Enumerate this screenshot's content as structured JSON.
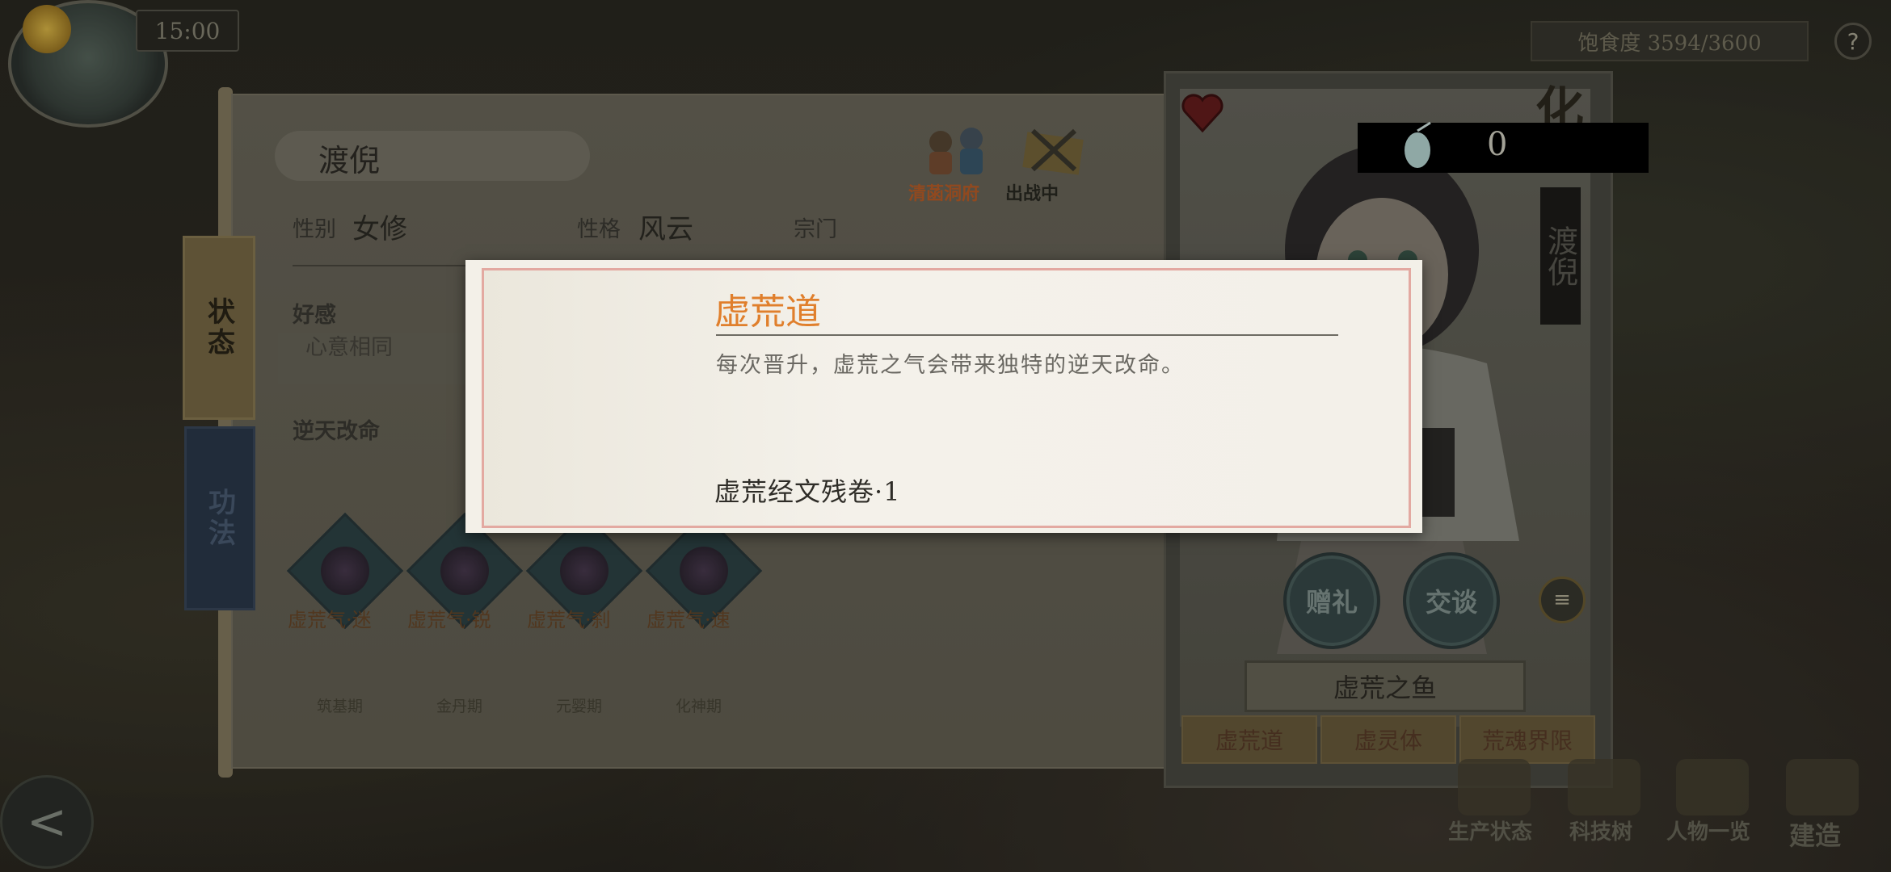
{
  "hud": {
    "time": "15:00",
    "satiety": "饱食度 3594/3600",
    "help_symbol": "?"
  },
  "character": {
    "name": "渡倪",
    "gender_label": "性别",
    "gender_value": "女修",
    "personality_label": "性格",
    "personality_value": "风云",
    "sect_label": "宗门",
    "favor_label": "好感",
    "favor_value": "心意相同",
    "fate_label": "逆天改命",
    "badges": [
      {
        "text": "清菡洞府",
        "color": "#c2622a"
      },
      {
        "text": "出战中",
        "color": "#2a2a22"
      }
    ]
  },
  "tabs": [
    {
      "label": "状态"
    },
    {
      "label": "功法"
    }
  ],
  "skills": [
    {
      "label": "虚荒气·迷",
      "stage": "筑基期"
    },
    {
      "label": "虚荒气·锐",
      "stage": "金丹期"
    },
    {
      "label": "虚荒气·刹",
      "stage": "元婴期"
    },
    {
      "label": "虚荒气·速",
      "stage": "化神期"
    }
  ],
  "card": {
    "corner_char": "化",
    "count": "0",
    "vertical_name": "渡倪",
    "gift_label": "赠礼",
    "talk_label": "交谈",
    "menu_symbol": "≡",
    "item_name": "虚荒之鱼",
    "bottom_tabs": [
      "虚荒道",
      "虚灵体",
      "荒魂界限"
    ]
  },
  "nav": {
    "back_symbol": "<",
    "items": [
      "生产状态",
      "科技树",
      "人物一览",
      "建造"
    ]
  },
  "popup": {
    "title": "虚荒道",
    "description": "每次晋升，虚荒之气会带来独特的逆天改命。",
    "item": "虚荒经文残卷·1"
  },
  "colors": {
    "popup_title": "#e07f2c",
    "popup_border": "#e3a9a1",
    "skill_label": "#6c4a2a"
  }
}
